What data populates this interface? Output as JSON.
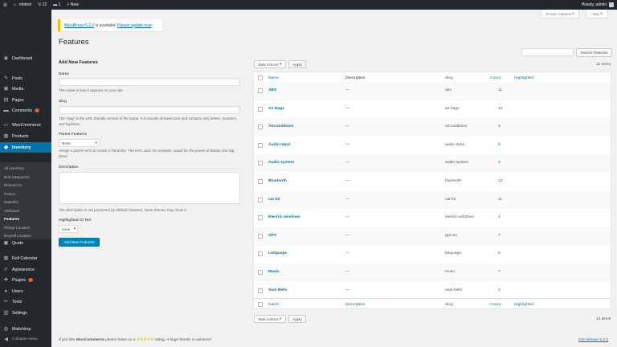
{
  "adminbar": {
    "site_name": "mbtest",
    "updates_count": "12",
    "comments_count": "1",
    "new_label": "New",
    "howdy": "Howdy, admin"
  },
  "screen_options": "Screen Options",
  "help": "Help",
  "sidebar": {
    "items": [
      {
        "label": "Dashboard",
        "icon": "dashboard-icon",
        "glyph": "◉"
      },
      {
        "label": "Posts",
        "icon": "pin-icon",
        "glyph": "✎"
      },
      {
        "label": "Media",
        "icon": "media-icon",
        "glyph": "▣"
      },
      {
        "label": "Pages",
        "icon": "pages-icon",
        "glyph": "▤"
      },
      {
        "label": "Comments",
        "icon": "comments-icon",
        "glyph": "▬",
        "badge": "1"
      },
      {
        "label": "WooCommerce",
        "icon": "woocommerce-icon",
        "glyph": "▭"
      },
      {
        "label": "Products",
        "icon": "products-icon",
        "glyph": "▦"
      },
      {
        "label": "Inventory",
        "icon": "inventory-icon",
        "glyph": "◆"
      },
      {
        "label": "Quote",
        "icon": "quote-icon",
        "glyph": "◼"
      },
      {
        "label": "Roll Calendar",
        "icon": "calendar-icon",
        "glyph": "▦"
      },
      {
        "label": "Appearance",
        "icon": "brush-icon",
        "glyph": "✐"
      },
      {
        "label": "Plugins",
        "icon": "plugin-icon",
        "glyph": "✚",
        "badge": "7"
      },
      {
        "label": "Users",
        "icon": "users-icon",
        "glyph": "●"
      },
      {
        "label": "Tools",
        "icon": "tools-icon",
        "glyph": "✂"
      },
      {
        "label": "Settings",
        "icon": "settings-icon",
        "glyph": "▥"
      },
      {
        "label": "Mailchimp",
        "icon": "mailchimp-icon",
        "glyph": "◍"
      },
      {
        "label": "Collapse menu",
        "icon": "collapse-icon",
        "glyph": "◀"
      }
    ],
    "submenu": [
      "All inventory",
      "Bnb Categories",
      "Resources",
      "Person",
      "Deposits",
      "Attributes",
      "Features",
      "Pickup Location",
      "Dropoff Location"
    ]
  },
  "notice": {
    "link_version": "WordPress 5.2.2",
    "middle": " is available! ",
    "link_update": "Please update now",
    "end": "."
  },
  "page_title": "Features",
  "form": {
    "heading": "Add New Features",
    "name_label": "Name",
    "name_desc": "The name is how it appears on your site.",
    "slug_label": "Slug",
    "slug_desc": "The “slug” is the URL-friendly version of the name. It is usually all lowercase and contains only letters, numbers, and hyphens.",
    "parent_label": "Parent Features",
    "parent_value": "None",
    "parent_desc": "Assign a parent term to create a hierarchy. The term Jazz, for example, would be the parent of Bebop and Big Band.",
    "description_label": "Description",
    "description_desc": "The description is not prominent by default; however, some themes may show it.",
    "highlighted_label": "Highlighted Or Not",
    "highlighted_value": "none",
    "submit": "Add New Features"
  },
  "search_button": "Search Features",
  "bulk_actions": "Bulk Actions",
  "apply": "Apply",
  "items_count": "12 items",
  "table": {
    "headers": {
      "name": "Name",
      "description": "Description",
      "slug": "Slug",
      "count": "Count",
      "highlighted": "Highlighted"
    },
    "rows": [
      {
        "name": "ABS",
        "description": "—",
        "slug": "abs",
        "count": "11"
      },
      {
        "name": "Air Bags",
        "description": "—",
        "slug": "air-bags",
        "count": "12"
      },
      {
        "name": "Airconditions",
        "description": "—",
        "slug": "airconditions",
        "count": "4"
      },
      {
        "name": "Audio Input",
        "description": "—",
        "slug": "audio-input",
        "count": "8"
      },
      {
        "name": "Audio system",
        "description": "—",
        "slug": "audio-system",
        "count": "3"
      },
      {
        "name": "Bluetooth",
        "description": "—",
        "slug": "bluetooth",
        "count": "13"
      },
      {
        "name": "car kit",
        "description": "—",
        "slug": "car-kit",
        "count": "11"
      },
      {
        "name": "Electric windows",
        "description": "—",
        "slug": "electric-windows",
        "count": "1"
      },
      {
        "name": "GPS",
        "description": "—",
        "slug": "gps-en",
        "count": "7"
      },
      {
        "name": "Language",
        "description": "—",
        "slug": "language",
        "count": "5"
      },
      {
        "name": "Music",
        "description": "—",
        "slug": "music",
        "count": "7"
      },
      {
        "name": "Seat Belts",
        "description": "—",
        "slug": "seat-belts",
        "count": "4"
      }
    ]
  },
  "footer": {
    "pre": "If you like ",
    "brand": "WooCommerce",
    "mid": " please leave us a ",
    "stars": "★★★★★",
    "post": " rating. A huge thanks in advance!",
    "version": "Get Version 5.2.2"
  }
}
